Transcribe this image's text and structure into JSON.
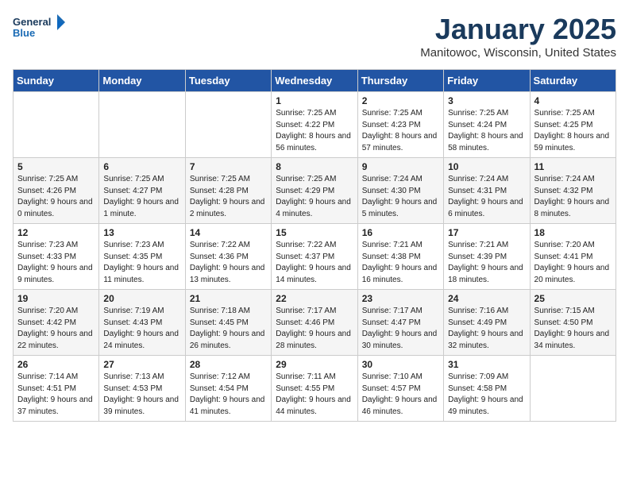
{
  "header": {
    "logo_line1": "General",
    "logo_line2": "Blue",
    "month": "January 2025",
    "location": "Manitowoc, Wisconsin, United States"
  },
  "days_of_week": [
    "Sunday",
    "Monday",
    "Tuesday",
    "Wednesday",
    "Thursday",
    "Friday",
    "Saturday"
  ],
  "weeks": [
    [
      {
        "day": "",
        "info": ""
      },
      {
        "day": "",
        "info": ""
      },
      {
        "day": "",
        "info": ""
      },
      {
        "day": "1",
        "info": "Sunrise: 7:25 AM\nSunset: 4:22 PM\nDaylight: 8 hours and 56 minutes."
      },
      {
        "day": "2",
        "info": "Sunrise: 7:25 AM\nSunset: 4:23 PM\nDaylight: 8 hours and 57 minutes."
      },
      {
        "day": "3",
        "info": "Sunrise: 7:25 AM\nSunset: 4:24 PM\nDaylight: 8 hours and 58 minutes."
      },
      {
        "day": "4",
        "info": "Sunrise: 7:25 AM\nSunset: 4:25 PM\nDaylight: 8 hours and 59 minutes."
      }
    ],
    [
      {
        "day": "5",
        "info": "Sunrise: 7:25 AM\nSunset: 4:26 PM\nDaylight: 9 hours and 0 minutes."
      },
      {
        "day": "6",
        "info": "Sunrise: 7:25 AM\nSunset: 4:27 PM\nDaylight: 9 hours and 1 minute."
      },
      {
        "day": "7",
        "info": "Sunrise: 7:25 AM\nSunset: 4:28 PM\nDaylight: 9 hours and 2 minutes."
      },
      {
        "day": "8",
        "info": "Sunrise: 7:25 AM\nSunset: 4:29 PM\nDaylight: 9 hours and 4 minutes."
      },
      {
        "day": "9",
        "info": "Sunrise: 7:24 AM\nSunset: 4:30 PM\nDaylight: 9 hours and 5 minutes."
      },
      {
        "day": "10",
        "info": "Sunrise: 7:24 AM\nSunset: 4:31 PM\nDaylight: 9 hours and 6 minutes."
      },
      {
        "day": "11",
        "info": "Sunrise: 7:24 AM\nSunset: 4:32 PM\nDaylight: 9 hours and 8 minutes."
      }
    ],
    [
      {
        "day": "12",
        "info": "Sunrise: 7:23 AM\nSunset: 4:33 PM\nDaylight: 9 hours and 9 minutes."
      },
      {
        "day": "13",
        "info": "Sunrise: 7:23 AM\nSunset: 4:35 PM\nDaylight: 9 hours and 11 minutes."
      },
      {
        "day": "14",
        "info": "Sunrise: 7:22 AM\nSunset: 4:36 PM\nDaylight: 9 hours and 13 minutes."
      },
      {
        "day": "15",
        "info": "Sunrise: 7:22 AM\nSunset: 4:37 PM\nDaylight: 9 hours and 14 minutes."
      },
      {
        "day": "16",
        "info": "Sunrise: 7:21 AM\nSunset: 4:38 PM\nDaylight: 9 hours and 16 minutes."
      },
      {
        "day": "17",
        "info": "Sunrise: 7:21 AM\nSunset: 4:39 PM\nDaylight: 9 hours and 18 minutes."
      },
      {
        "day": "18",
        "info": "Sunrise: 7:20 AM\nSunset: 4:41 PM\nDaylight: 9 hours and 20 minutes."
      }
    ],
    [
      {
        "day": "19",
        "info": "Sunrise: 7:20 AM\nSunset: 4:42 PM\nDaylight: 9 hours and 22 minutes."
      },
      {
        "day": "20",
        "info": "Sunrise: 7:19 AM\nSunset: 4:43 PM\nDaylight: 9 hours and 24 minutes."
      },
      {
        "day": "21",
        "info": "Sunrise: 7:18 AM\nSunset: 4:45 PM\nDaylight: 9 hours and 26 minutes."
      },
      {
        "day": "22",
        "info": "Sunrise: 7:17 AM\nSunset: 4:46 PM\nDaylight: 9 hours and 28 minutes."
      },
      {
        "day": "23",
        "info": "Sunrise: 7:17 AM\nSunset: 4:47 PM\nDaylight: 9 hours and 30 minutes."
      },
      {
        "day": "24",
        "info": "Sunrise: 7:16 AM\nSunset: 4:49 PM\nDaylight: 9 hours and 32 minutes."
      },
      {
        "day": "25",
        "info": "Sunrise: 7:15 AM\nSunset: 4:50 PM\nDaylight: 9 hours and 34 minutes."
      }
    ],
    [
      {
        "day": "26",
        "info": "Sunrise: 7:14 AM\nSunset: 4:51 PM\nDaylight: 9 hours and 37 minutes."
      },
      {
        "day": "27",
        "info": "Sunrise: 7:13 AM\nSunset: 4:53 PM\nDaylight: 9 hours and 39 minutes."
      },
      {
        "day": "28",
        "info": "Sunrise: 7:12 AM\nSunset: 4:54 PM\nDaylight: 9 hours and 41 minutes."
      },
      {
        "day": "29",
        "info": "Sunrise: 7:11 AM\nSunset: 4:55 PM\nDaylight: 9 hours and 44 minutes."
      },
      {
        "day": "30",
        "info": "Sunrise: 7:10 AM\nSunset: 4:57 PM\nDaylight: 9 hours and 46 minutes."
      },
      {
        "day": "31",
        "info": "Sunrise: 7:09 AM\nSunset: 4:58 PM\nDaylight: 9 hours and 49 minutes."
      },
      {
        "day": "",
        "info": ""
      }
    ]
  ]
}
